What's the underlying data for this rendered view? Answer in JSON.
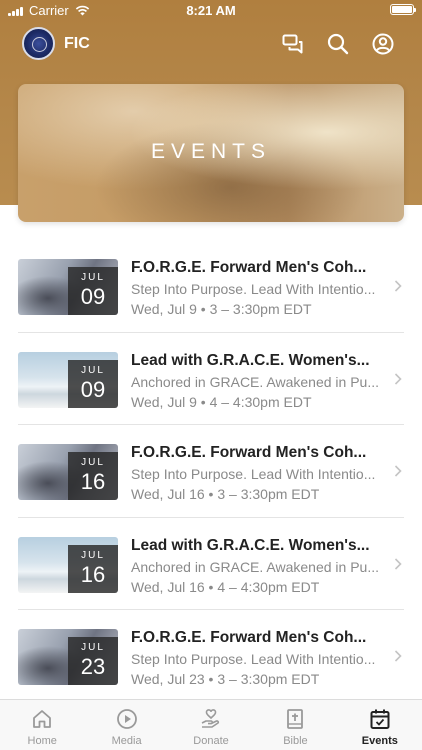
{
  "status_bar": {
    "carrier": "Carrier",
    "time": "8:21 AM"
  },
  "header": {
    "brand": "FIC",
    "icons": [
      "chat-icon",
      "search-icon",
      "profile-icon"
    ]
  },
  "hero": {
    "title": "EVENTS"
  },
  "events": [
    {
      "month": "JUL",
      "day": "09",
      "title": "F.O.R.G.E. Forward Men's Coh...",
      "subtitle": "Step Into Purpose. Lead With Intentio...",
      "time": "Wed, Jul 9 • 3 – 3:30pm EDT",
      "thumbnail": "men"
    },
    {
      "month": "JUL",
      "day": "09",
      "title": "Lead with G.R.A.C.E. Women's...",
      "subtitle": "Anchored in GRACE. Awakened in Pu...",
      "time": "Wed, Jul 9 • 4 – 4:30pm EDT",
      "thumbnail": "women"
    },
    {
      "month": "JUL",
      "day": "16",
      "title": "F.O.R.G.E. Forward Men's Coh...",
      "subtitle": "Step Into Purpose. Lead With Intentio...",
      "time": "Wed, Jul 16 • 3 – 3:30pm EDT",
      "thumbnail": "men"
    },
    {
      "month": "JUL",
      "day": "16",
      "title": "Lead with G.R.A.C.E. Women's...",
      "subtitle": "Anchored in GRACE. Awakened in Pu...",
      "time": "Wed, Jul 16 • 4 – 4:30pm EDT",
      "thumbnail": "women"
    },
    {
      "month": "JUL",
      "day": "23",
      "title": "F.O.R.G.E. Forward Men's Coh...",
      "subtitle": "Step Into Purpose. Lead With Intentio...",
      "time": "Wed, Jul 23 • 3 – 3:30pm EDT",
      "thumbnail": "men"
    }
  ],
  "tab_bar": {
    "tabs": [
      {
        "label": "Home",
        "icon": "home-icon",
        "active": false
      },
      {
        "label": "Media",
        "icon": "play-icon",
        "active": false
      },
      {
        "label": "Donate",
        "icon": "donate-icon",
        "active": false
      },
      {
        "label": "Bible",
        "icon": "bible-icon",
        "active": false
      },
      {
        "label": "Events",
        "icon": "calendar-icon",
        "active": true
      }
    ]
  },
  "colors": {
    "header_gold": "#b07f3f",
    "tab_active": "#222222",
    "tab_inactive": "#999999"
  }
}
